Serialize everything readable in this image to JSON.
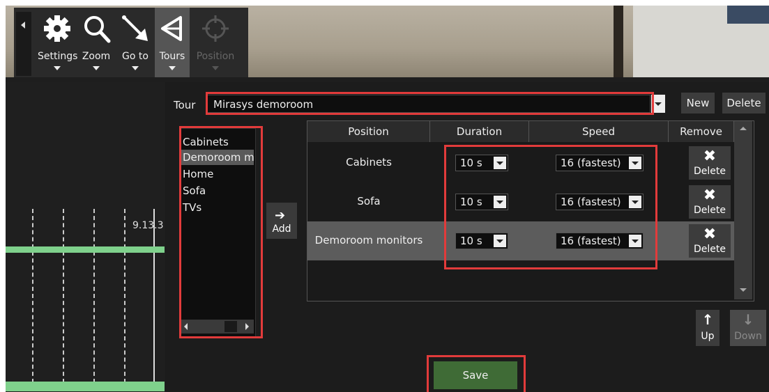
{
  "toolbar": {
    "buttons": [
      {
        "label": "Settings",
        "icon": "gear-icon"
      },
      {
        "label": "Zoom",
        "icon": "magnifier-icon"
      },
      {
        "label": "Go to",
        "icon": "goto-arrow-icon"
      },
      {
        "label": "Tours",
        "icon": "tour-icon"
      },
      {
        "label": "Position",
        "icon": "crosshair-icon"
      }
    ]
  },
  "timeline": {
    "time_label": "9.13.3"
  },
  "tour": {
    "label": "Tour",
    "selected": "Mirasys demoroom",
    "new_label": "New",
    "delete_label": "Delete"
  },
  "presets": [
    "Cabinets",
    "Demoroom m",
    "Home",
    "Sofa",
    "TVs"
  ],
  "add_label": "Add",
  "table": {
    "headers": [
      "Position",
      "Duration",
      "Speed",
      "Remove"
    ],
    "rows": [
      {
        "position": "Cabinets",
        "duration": "10 s",
        "speed": "16 (fastest)",
        "remove": "Delete"
      },
      {
        "position": "Sofa",
        "duration": "10 s",
        "speed": "16 (fastest)",
        "remove": "Delete"
      },
      {
        "position": "Demoroom monitors",
        "duration": "10 s",
        "speed": "16 (fastest)",
        "remove": "Delete"
      }
    ]
  },
  "up_label": "Up",
  "down_label": "Down",
  "save_label": "Save",
  "colors": {
    "highlight": "#e23b3b",
    "save_green": "#3f6b36",
    "timeline_green": "#7fd18c"
  }
}
